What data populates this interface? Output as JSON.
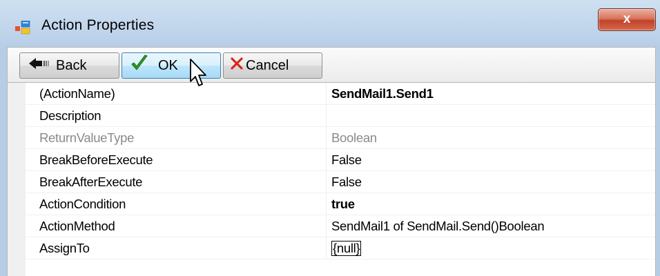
{
  "window": {
    "title": "Action Properties",
    "close_label": "x"
  },
  "toolbar": {
    "back_label": "Back",
    "ok_label": "OK",
    "cancel_label": "Cancel"
  },
  "properties": [
    {
      "name": "(ActionName)",
      "value": "SendMail1.Send1",
      "style": "bold"
    },
    {
      "name": "Description",
      "value": "",
      "style": "normal"
    },
    {
      "name": "ReturnValueType",
      "value": "Boolean",
      "style": "disabled"
    },
    {
      "name": "BreakBeforeExecute",
      "value": "False",
      "style": "normal"
    },
    {
      "name": "BreakAfterExecute",
      "value": "False",
      "style": "normal"
    },
    {
      "name": "ActionCondition",
      "value": "true",
      "style": "bold"
    },
    {
      "name": "ActionMethod",
      "value": "SendMail1 of SendMail.Send()Boolean",
      "style": "normal"
    },
    {
      "name": "AssignTo",
      "value": "{null}",
      "style": "boxed"
    }
  ],
  "icons": {
    "app": "properties-window-icon",
    "back": "back-arrow-icon",
    "ok": "green-check-icon",
    "cancel": "red-x-icon",
    "cursor": "mouse-pointer-icon"
  },
  "colors": {
    "title_bg": "#c9d9ea",
    "close_button": "#c9472d",
    "ok_check": "#2e9a1e",
    "cancel_x": "#d8261a",
    "disabled_text": "#8a8a8a"
  }
}
